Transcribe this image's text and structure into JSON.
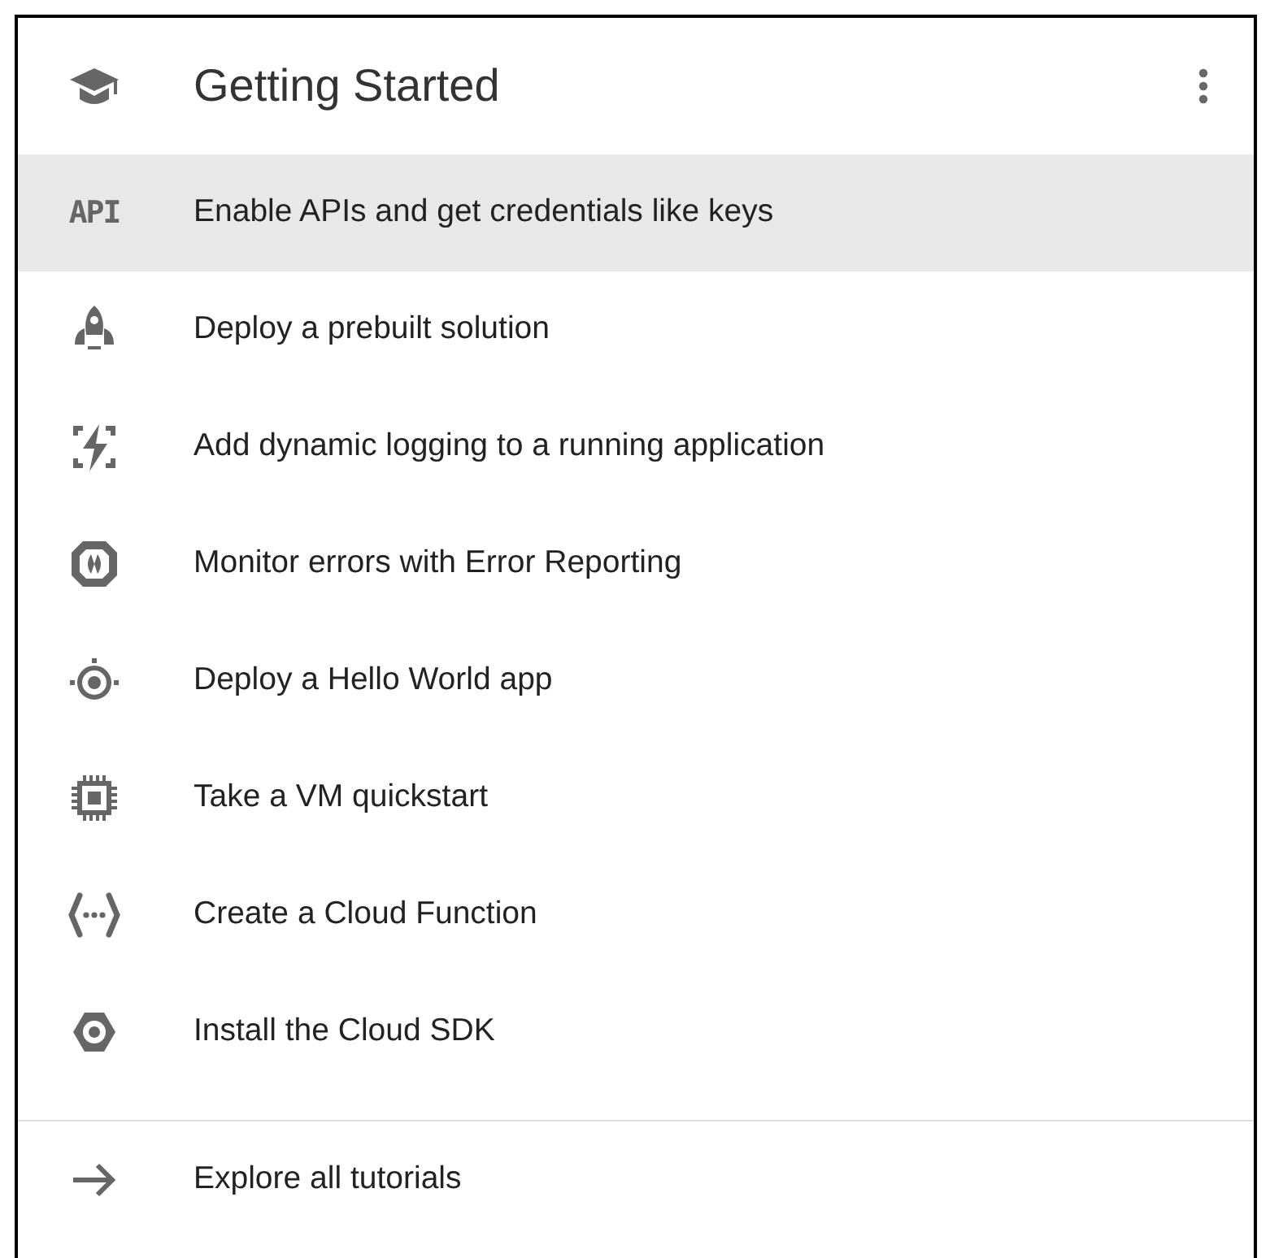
{
  "card": {
    "title": "Getting Started"
  },
  "items": [
    {
      "icon_text": "API",
      "label": "Enable APIs and get credentials like keys",
      "selected": true
    },
    {
      "label": "Deploy a prebuilt solution",
      "selected": false
    },
    {
      "label": "Add dynamic logging to a running application",
      "selected": false
    },
    {
      "label": "Monitor errors with Error Reporting",
      "selected": false
    },
    {
      "label": "Deploy a Hello World app",
      "selected": false
    },
    {
      "label": "Take a VM quickstart",
      "selected": false
    },
    {
      "label": "Create a Cloud Function",
      "selected": false
    },
    {
      "label": "Install the Cloud SDK",
      "selected": false
    }
  ],
  "footer": {
    "label": "Explore all tutorials"
  }
}
